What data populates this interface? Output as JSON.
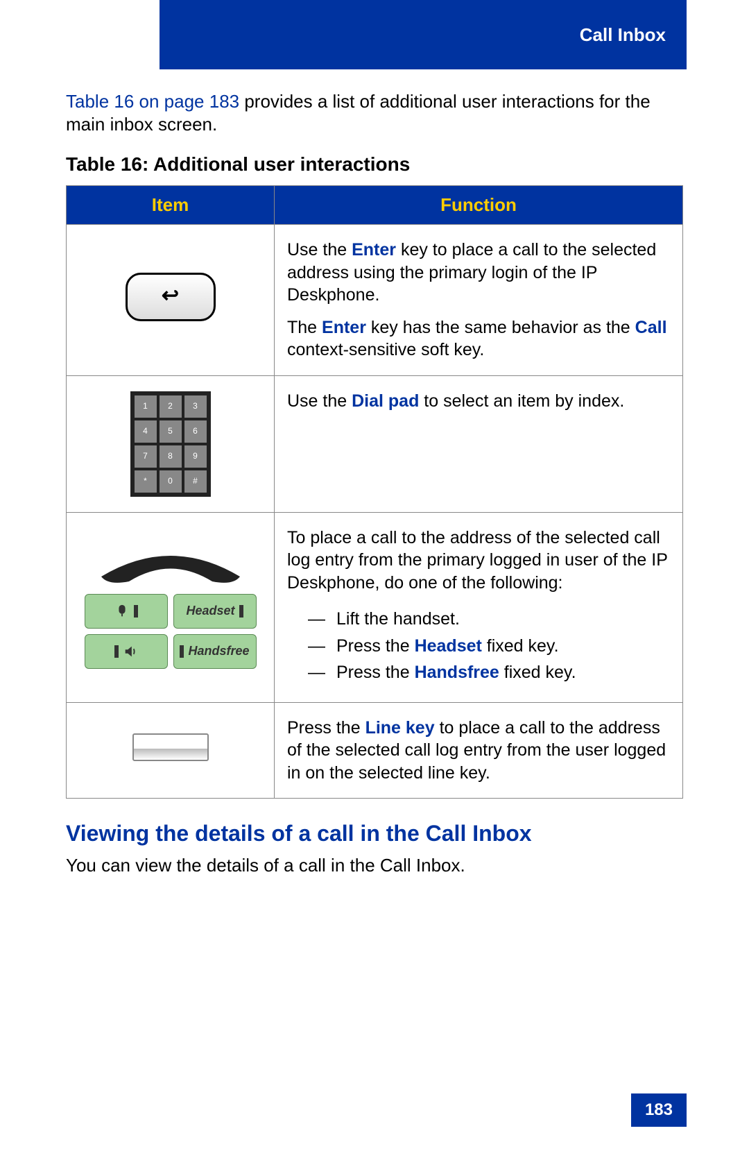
{
  "header": {
    "section": "Call Inbox"
  },
  "intro": {
    "xref": "Table 16 on page 183",
    "rest": " provides a list of additional user interactions for the main inbox screen."
  },
  "table": {
    "caption": "Table 16: Additional user interactions",
    "headers": {
      "item": "Item",
      "function": "Function"
    },
    "rows": [
      {
        "icon": "enter-key",
        "para1_pre": "Use the ",
        "para1_kw": "Enter",
        "para1_post": " key to place a call to the selected address using the primary login of the IP Deskphone.",
        "para2_pre": "The ",
        "para2_kw1": "Enter",
        "para2_mid": " key has the same behavior as the ",
        "para2_kw2": "Call",
        "para2_post": " context-sensitive soft key."
      },
      {
        "icon": "dial-pad",
        "keys": [
          "1",
          "2",
          "3",
          "4",
          "5",
          "6",
          "7",
          "8",
          "9",
          "*",
          "0",
          "#"
        ],
        "para_pre": "Use the ",
        "para_kw": "Dial pad",
        "para_post": " to select an item by index."
      },
      {
        "icon": "handset-headset-handsfree",
        "btnHeadset": "Headset",
        "btnHandsfree": "Handsfree",
        "intro": "To place a call to the address of the selected call log entry from the primary logged in user of the IP Deskphone, do one of the following:",
        "opt1": "Lift the handset.",
        "opt2_pre": "Press the ",
        "opt2_kw": "Headset",
        "opt2_post": " fixed key.",
        "opt3_pre": "Press the ",
        "opt3_kw": "Handsfree",
        "opt3_post": " fixed key."
      },
      {
        "icon": "line-key",
        "para_pre": "Press the ",
        "para_kw": "Line key",
        "para_post": " to place a call to the address of the selected call log entry from the user logged in on the selected line key."
      }
    ]
  },
  "heading": "Viewing the details of a call in the Call Inbox",
  "body": "You can view the details of a call in the Call Inbox.",
  "pageNumber": "183"
}
